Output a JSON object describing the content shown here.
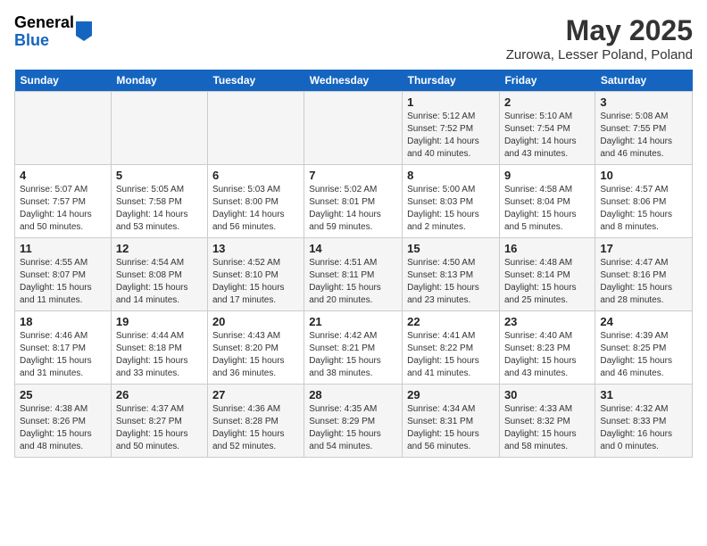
{
  "header": {
    "logo_general": "General",
    "logo_blue": "Blue",
    "month": "May 2025",
    "location": "Zurowa, Lesser Poland, Poland"
  },
  "weekdays": [
    "Sunday",
    "Monday",
    "Tuesday",
    "Wednesday",
    "Thursday",
    "Friday",
    "Saturday"
  ],
  "weeks": [
    [
      {
        "day": "",
        "info": ""
      },
      {
        "day": "",
        "info": ""
      },
      {
        "day": "",
        "info": ""
      },
      {
        "day": "",
        "info": ""
      },
      {
        "day": "1",
        "info": "Sunrise: 5:12 AM\nSunset: 7:52 PM\nDaylight: 14 hours\nand 40 minutes."
      },
      {
        "day": "2",
        "info": "Sunrise: 5:10 AM\nSunset: 7:54 PM\nDaylight: 14 hours\nand 43 minutes."
      },
      {
        "day": "3",
        "info": "Sunrise: 5:08 AM\nSunset: 7:55 PM\nDaylight: 14 hours\nand 46 minutes."
      }
    ],
    [
      {
        "day": "4",
        "info": "Sunrise: 5:07 AM\nSunset: 7:57 PM\nDaylight: 14 hours\nand 50 minutes."
      },
      {
        "day": "5",
        "info": "Sunrise: 5:05 AM\nSunset: 7:58 PM\nDaylight: 14 hours\nand 53 minutes."
      },
      {
        "day": "6",
        "info": "Sunrise: 5:03 AM\nSunset: 8:00 PM\nDaylight: 14 hours\nand 56 minutes."
      },
      {
        "day": "7",
        "info": "Sunrise: 5:02 AM\nSunset: 8:01 PM\nDaylight: 14 hours\nand 59 minutes."
      },
      {
        "day": "8",
        "info": "Sunrise: 5:00 AM\nSunset: 8:03 PM\nDaylight: 15 hours\nand 2 minutes."
      },
      {
        "day": "9",
        "info": "Sunrise: 4:58 AM\nSunset: 8:04 PM\nDaylight: 15 hours\nand 5 minutes."
      },
      {
        "day": "10",
        "info": "Sunrise: 4:57 AM\nSunset: 8:06 PM\nDaylight: 15 hours\nand 8 minutes."
      }
    ],
    [
      {
        "day": "11",
        "info": "Sunrise: 4:55 AM\nSunset: 8:07 PM\nDaylight: 15 hours\nand 11 minutes."
      },
      {
        "day": "12",
        "info": "Sunrise: 4:54 AM\nSunset: 8:08 PM\nDaylight: 15 hours\nand 14 minutes."
      },
      {
        "day": "13",
        "info": "Sunrise: 4:52 AM\nSunset: 8:10 PM\nDaylight: 15 hours\nand 17 minutes."
      },
      {
        "day": "14",
        "info": "Sunrise: 4:51 AM\nSunset: 8:11 PM\nDaylight: 15 hours\nand 20 minutes."
      },
      {
        "day": "15",
        "info": "Sunrise: 4:50 AM\nSunset: 8:13 PM\nDaylight: 15 hours\nand 23 minutes."
      },
      {
        "day": "16",
        "info": "Sunrise: 4:48 AM\nSunset: 8:14 PM\nDaylight: 15 hours\nand 25 minutes."
      },
      {
        "day": "17",
        "info": "Sunrise: 4:47 AM\nSunset: 8:16 PM\nDaylight: 15 hours\nand 28 minutes."
      }
    ],
    [
      {
        "day": "18",
        "info": "Sunrise: 4:46 AM\nSunset: 8:17 PM\nDaylight: 15 hours\nand 31 minutes."
      },
      {
        "day": "19",
        "info": "Sunrise: 4:44 AM\nSunset: 8:18 PM\nDaylight: 15 hours\nand 33 minutes."
      },
      {
        "day": "20",
        "info": "Sunrise: 4:43 AM\nSunset: 8:20 PM\nDaylight: 15 hours\nand 36 minutes."
      },
      {
        "day": "21",
        "info": "Sunrise: 4:42 AM\nSunset: 8:21 PM\nDaylight: 15 hours\nand 38 minutes."
      },
      {
        "day": "22",
        "info": "Sunrise: 4:41 AM\nSunset: 8:22 PM\nDaylight: 15 hours\nand 41 minutes."
      },
      {
        "day": "23",
        "info": "Sunrise: 4:40 AM\nSunset: 8:23 PM\nDaylight: 15 hours\nand 43 minutes."
      },
      {
        "day": "24",
        "info": "Sunrise: 4:39 AM\nSunset: 8:25 PM\nDaylight: 15 hours\nand 46 minutes."
      }
    ],
    [
      {
        "day": "25",
        "info": "Sunrise: 4:38 AM\nSunset: 8:26 PM\nDaylight: 15 hours\nand 48 minutes."
      },
      {
        "day": "26",
        "info": "Sunrise: 4:37 AM\nSunset: 8:27 PM\nDaylight: 15 hours\nand 50 minutes."
      },
      {
        "day": "27",
        "info": "Sunrise: 4:36 AM\nSunset: 8:28 PM\nDaylight: 15 hours\nand 52 minutes."
      },
      {
        "day": "28",
        "info": "Sunrise: 4:35 AM\nSunset: 8:29 PM\nDaylight: 15 hours\nand 54 minutes."
      },
      {
        "day": "29",
        "info": "Sunrise: 4:34 AM\nSunset: 8:31 PM\nDaylight: 15 hours\nand 56 minutes."
      },
      {
        "day": "30",
        "info": "Sunrise: 4:33 AM\nSunset: 8:32 PM\nDaylight: 15 hours\nand 58 minutes."
      },
      {
        "day": "31",
        "info": "Sunrise: 4:32 AM\nSunset: 8:33 PM\nDaylight: 16 hours\nand 0 minutes."
      }
    ]
  ]
}
